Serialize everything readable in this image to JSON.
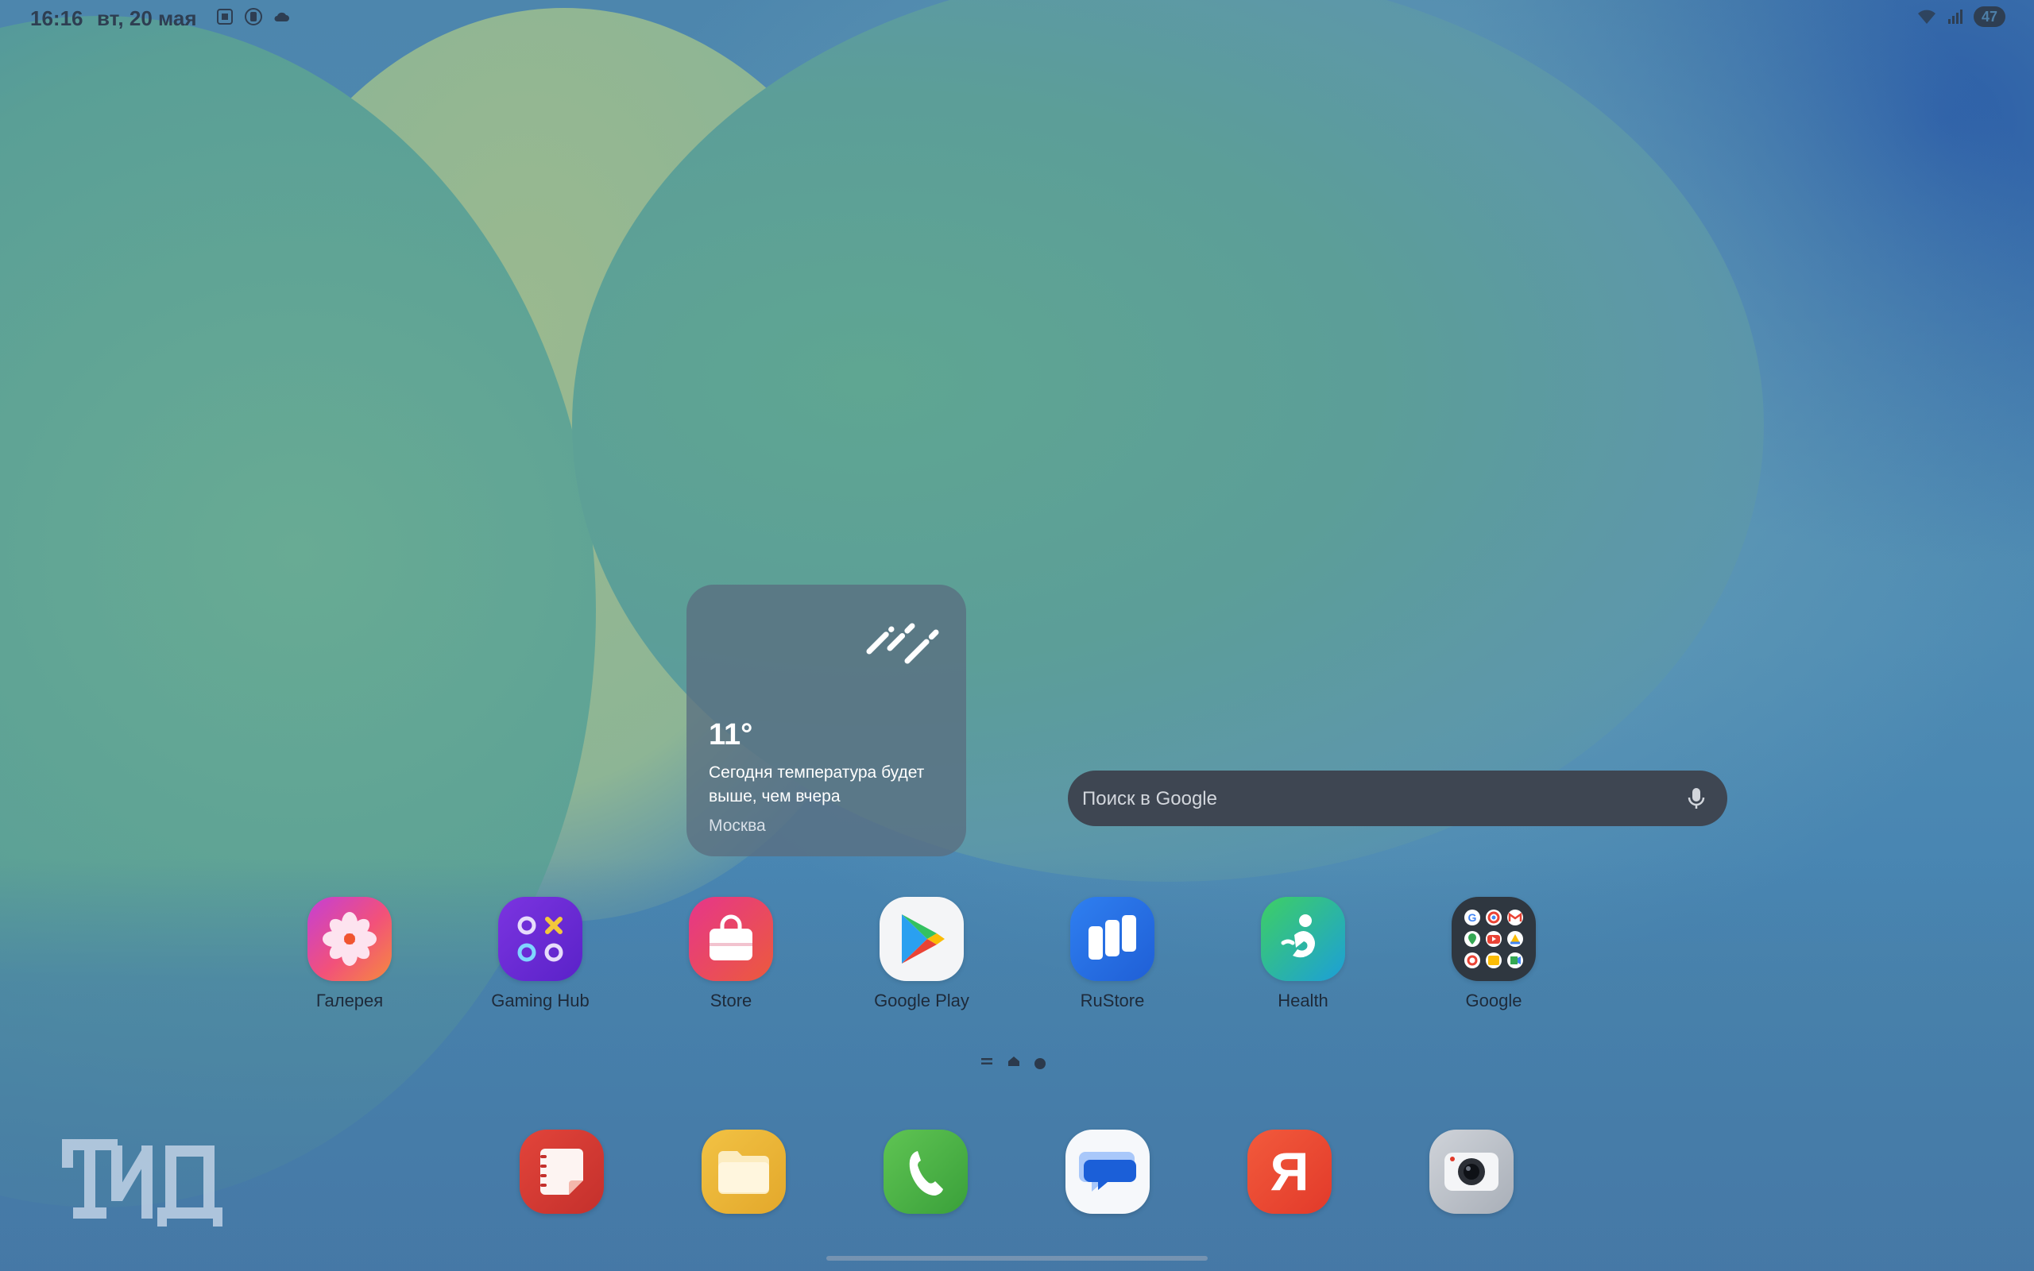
{
  "status_bar": {
    "time": "16:16",
    "date": "вт, 20 мая",
    "battery": "47"
  },
  "weather_widget": {
    "temperature": "11°",
    "description": "Сегодня температура будет выше, чем вчера",
    "city": "Москва",
    "icon": "rain-icon"
  },
  "search_bar": {
    "placeholder": "Поиск в Google",
    "icon": "mic-icon"
  },
  "apps": [
    {
      "label": "Галерея",
      "icon": "gallery-flower-icon"
    },
    {
      "label": "Gaming Hub",
      "icon": "gaming-hub-icon"
    },
    {
      "label": "Store",
      "icon": "shopping-bag-icon"
    },
    {
      "label": "Google Play",
      "icon": "play-triangle-icon"
    },
    {
      "label": "RuStore",
      "icon": "rustore-icon"
    },
    {
      "label": "Health",
      "icon": "health-figure-icon"
    },
    {
      "label": "Google",
      "icon": "folder-grid-icon"
    }
  ],
  "dock": [
    {
      "icon": "notes-icon"
    },
    {
      "icon": "files-folder-icon"
    },
    {
      "icon": "phone-icon"
    },
    {
      "icon": "messages-icon"
    },
    {
      "icon": "yandex-icon",
      "glyph": "Я"
    },
    {
      "icon": "camera-icon"
    }
  ],
  "colors": {
    "gallery": "#e0457a",
    "gaming_hub": "#6a2fd6",
    "store": "#e2475a",
    "rustore": "#2a6ee6",
    "health": "#38b463",
    "phone": "#4fb548",
    "yandex": "#ee4a35",
    "files": "#e8b43a"
  }
}
